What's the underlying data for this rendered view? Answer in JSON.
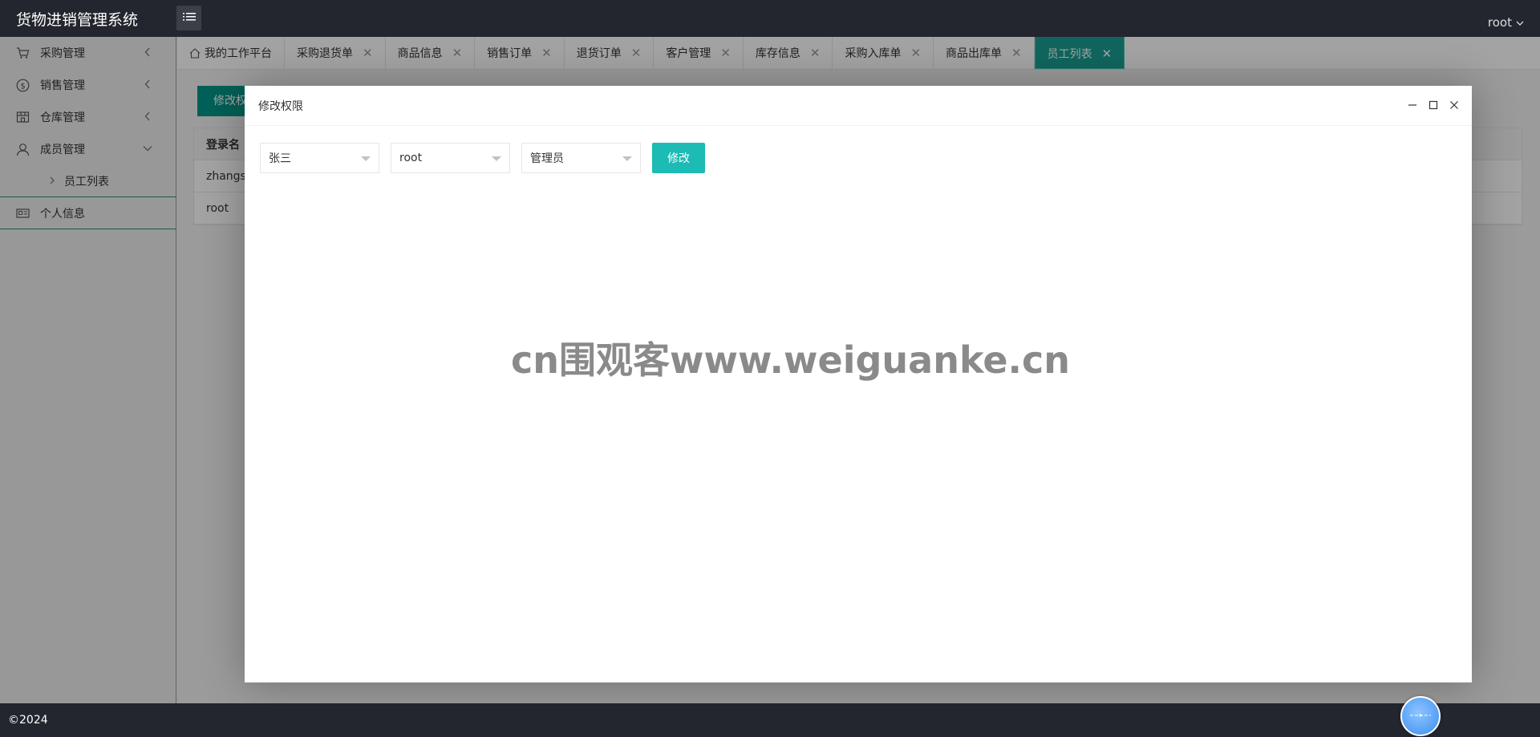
{
  "header": {
    "app_title": "货物进销管理系统",
    "user_name": "root"
  },
  "sidebar": {
    "items": [
      {
        "label": "采购管理",
        "icon": "cart-icon"
      },
      {
        "label": "销售管理",
        "icon": "dollar-icon"
      },
      {
        "label": "仓库管理",
        "icon": "store-icon"
      },
      {
        "label": "成员管理",
        "icon": "user-icon",
        "expanded": true,
        "children": [
          {
            "label": "员工列表"
          }
        ]
      },
      {
        "label": "个人信息",
        "icon": "id-card-icon"
      }
    ]
  },
  "tabs": [
    {
      "label": "我的工作平台",
      "closable": false,
      "icon": "home-icon"
    },
    {
      "label": "采购退货单",
      "closable": true
    },
    {
      "label": "商品信息",
      "closable": true
    },
    {
      "label": "销售订单",
      "closable": true
    },
    {
      "label": "退货订单",
      "closable": true
    },
    {
      "label": "客户管理",
      "closable": true
    },
    {
      "label": "库存信息",
      "closable": true
    },
    {
      "label": "采购入库单",
      "closable": true
    },
    {
      "label": "商品出库单",
      "closable": true
    },
    {
      "label": "员工列表",
      "closable": true,
      "active": true
    }
  ],
  "background_page": {
    "button_label": "修改权",
    "table_header": "登录名",
    "rows": [
      "zhangsa",
      "root"
    ]
  },
  "modal": {
    "title": "修改权限",
    "selects": [
      {
        "value": "张三"
      },
      {
        "value": "root"
      },
      {
        "value": "管理员"
      }
    ],
    "submit_label": "修改"
  },
  "watermark": "cn围观客www.weiguanke.cn",
  "footer": {
    "copyright": "©2024"
  },
  "colors": {
    "header_bg": "#23262e",
    "accent": "#1aa094",
    "button": "#1cbbb4"
  }
}
